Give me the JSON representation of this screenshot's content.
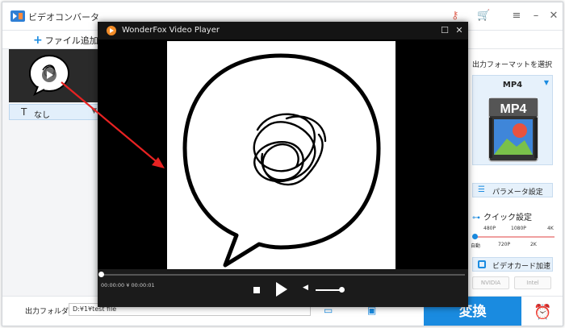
{
  "app": {
    "title": "ビデオコンバータ",
    "accent": "#1a8be0"
  },
  "toolbar": {
    "add_file_label": "ファイル追加"
  },
  "file_item": {
    "subtitle_value": "なし"
  },
  "output_panel": {
    "heading": "出力フォーマットを選択",
    "format": "MP4",
    "format_icon_text": "MP4",
    "parameter_label": "パラメータ設定",
    "quick_setting_label": "クイック設定",
    "quality_labels_top": [
      "480P",
      "1080P",
      "4K"
    ],
    "quality_labels_bottom": [
      "自動",
      "720P",
      "2K"
    ],
    "gpu_label": "ビデオカード加速",
    "gpu_vendors": [
      "NVIDIA",
      "Intel"
    ]
  },
  "bottom": {
    "output_folder_label": "出力フォルダ：",
    "output_path": "D:¥1¥test file",
    "convert_label": "変換"
  },
  "player": {
    "title": "WonderFox Video Player",
    "time": "00:00:00 ¥ 00:00:01",
    "progress": 0,
    "volume": 1.0
  },
  "icons": {
    "app_logo": "app-logo-icon",
    "key": "key-icon",
    "cart": "cart-icon",
    "menu": "menu-icon",
    "minimize": "minimize-icon",
    "close": "close-icon",
    "player_logo": "wonderfox-logo-icon",
    "maximize": "maximize-icon",
    "stop": "stop-icon",
    "play": "play-icon",
    "volume": "volume-icon",
    "folder": "folder-icon",
    "alarm": "alarm-clock-icon"
  }
}
